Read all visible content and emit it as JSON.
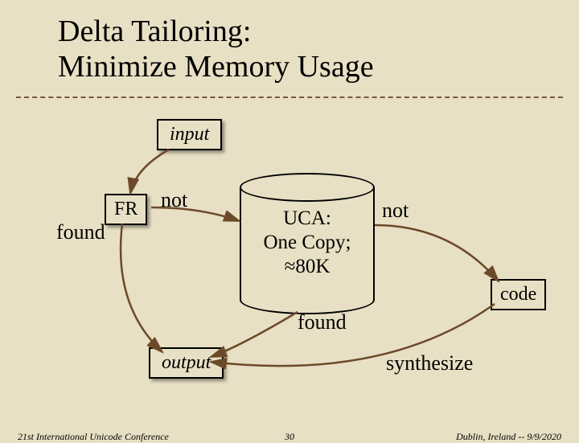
{
  "title": "Delta Tailoring:\nMinimize Memory Usage",
  "boxes": {
    "input": "input",
    "fr": "FR",
    "code": "code",
    "output": "output"
  },
  "cylinder": {
    "line1": "UCA:",
    "line2": "One Copy;",
    "line3": "≈80K"
  },
  "labels": {
    "not1": "not",
    "found1": "found",
    "not2": "not",
    "found2": "found",
    "synthesize": "synthesize"
  },
  "footer": {
    "left": "21st International Unicode Conference",
    "center": "30",
    "right": "Dublin, Ireland -- 9/9/2020"
  }
}
